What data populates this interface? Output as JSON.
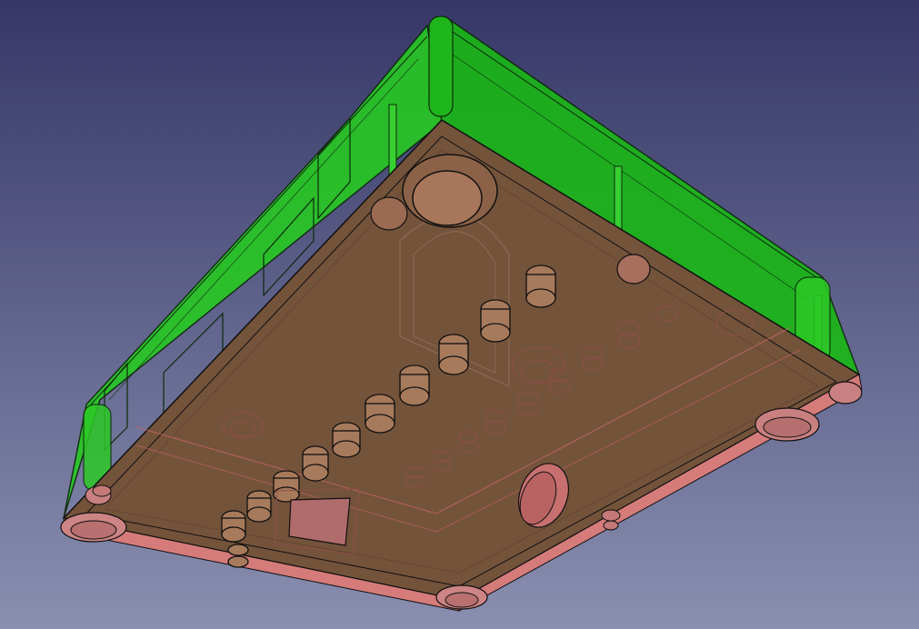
{
  "viewport": {
    "background_top": "#363767",
    "background_bottom": "#8a8fb0"
  },
  "model": {
    "lid_color": "#22c41e",
    "base_color": "#c8706b",
    "edge_color": "#101010"
  }
}
